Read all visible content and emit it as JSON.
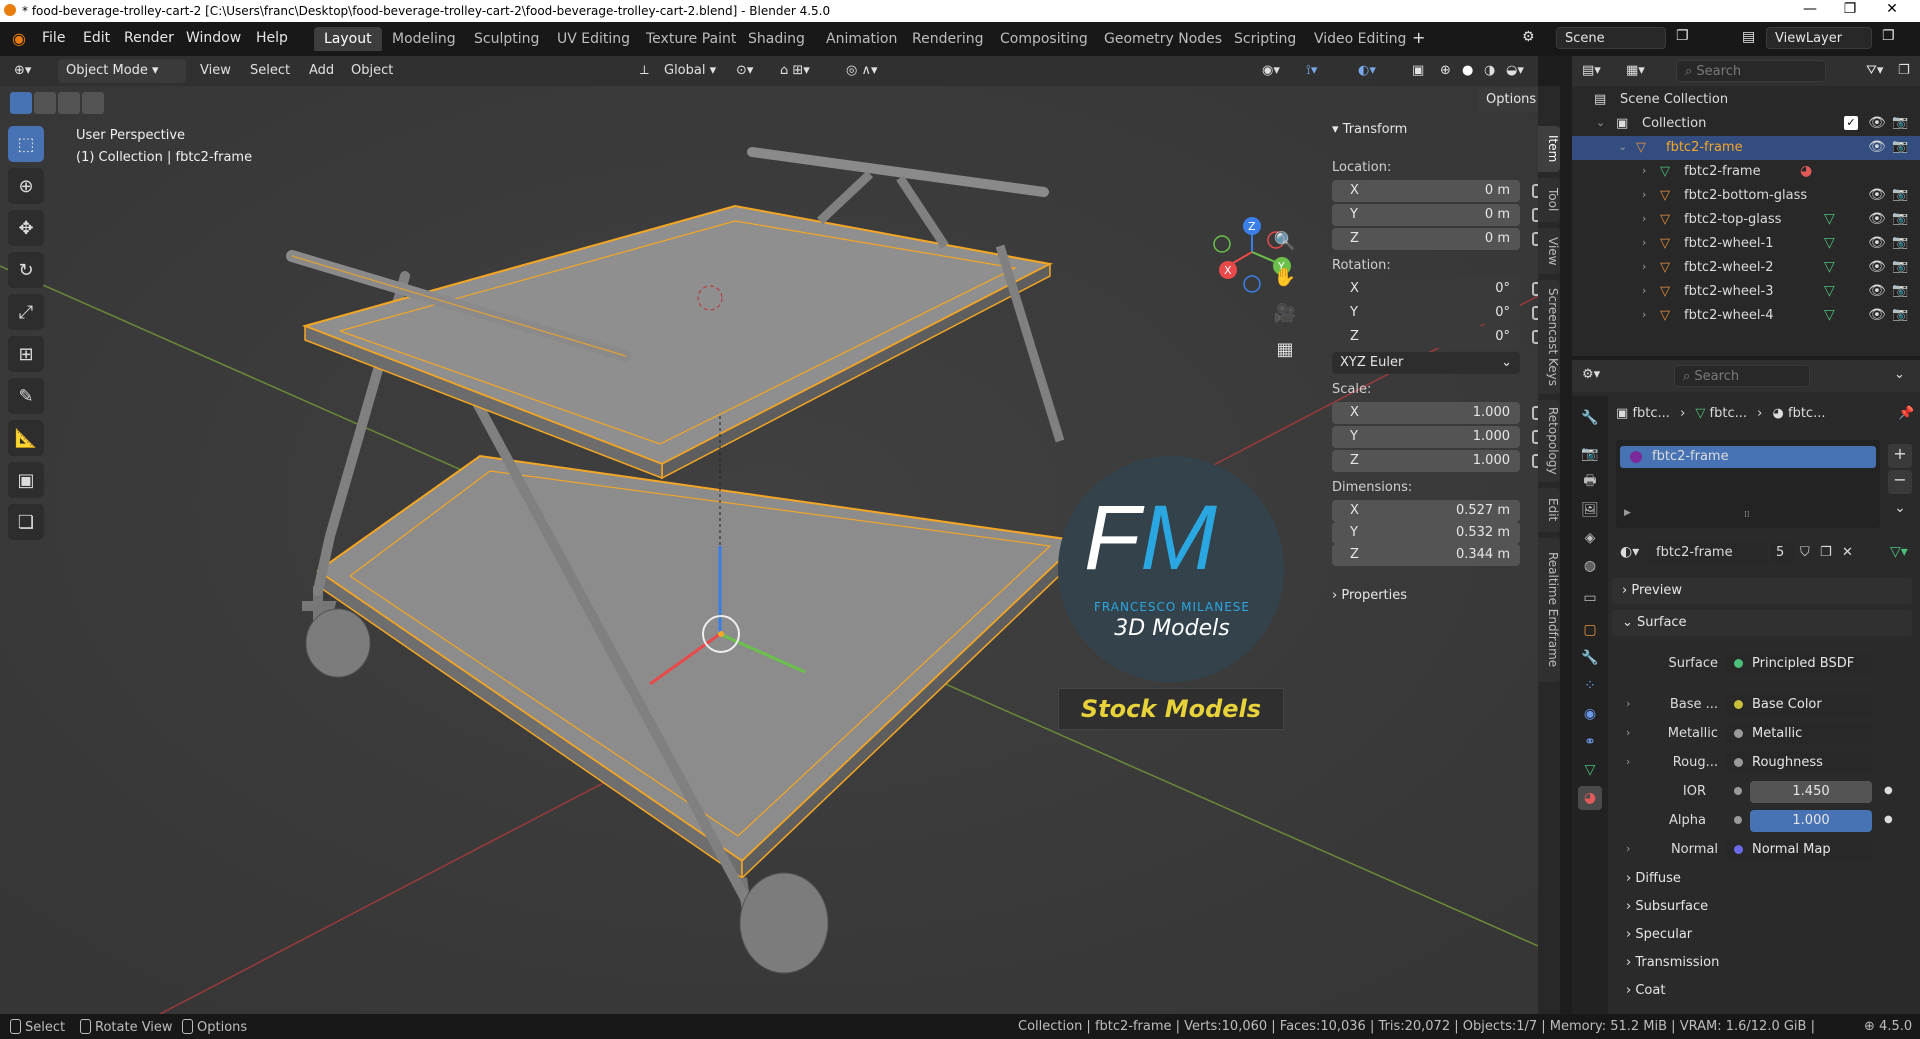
{
  "window": {
    "title": "* food-beverage-trolley-cart-2 [C:\\Users\\franc\\Desktop\\food-beverage-trolley-cart-2\\food-beverage-trolley-cart-2.blend] - Blender 4.5.0",
    "minimize": "—",
    "maximize": "❐",
    "close": "✕"
  },
  "menu": [
    "File",
    "Edit",
    "Render",
    "Window",
    "Help"
  ],
  "workspaces": [
    "Layout",
    "Modeling",
    "Sculpting",
    "UV Editing",
    "Texture Paint",
    "Shading",
    "Animation",
    "Rendering",
    "Compositing",
    "Geometry Nodes",
    "Scripting",
    "Video Editing"
  ],
  "add_workspace": "+",
  "scene": "Scene",
  "view_layer": "ViewLayer",
  "viewport_header": {
    "mode": "Object Mode",
    "menus": [
      "View",
      "Select",
      "Add",
      "Object"
    ],
    "transform_orientation": "Global",
    "options": "Options"
  },
  "viewport": {
    "perspective": "User Perspective",
    "context": "(1) Collection | fbtc2-frame",
    "gizmo_axes": {
      "x": "X",
      "y": "Y",
      "z": "Z"
    }
  },
  "badge": {
    "brand_left": "F",
    "brand_right": "M",
    "name": "FRANCESCO MILANESE",
    "sub": "3D Models",
    "banner": "Stock Models"
  },
  "transform": {
    "title": "Transform",
    "location_label": "Location:",
    "location": [
      {
        "axis": "X",
        "value": "0 m"
      },
      {
        "axis": "Y",
        "value": "0 m"
      },
      {
        "axis": "Z",
        "value": "0 m"
      }
    ],
    "rotation_label": "Rotation:",
    "rotation": [
      {
        "axis": "X",
        "value": "0°"
      },
      {
        "axis": "Y",
        "value": "0°"
      },
      {
        "axis": "Z",
        "value": "0°"
      }
    ],
    "rotation_mode": "XYZ Euler",
    "scale_label": "Scale:",
    "scale": [
      {
        "axis": "X",
        "value": "1.000"
      },
      {
        "axis": "Y",
        "value": "1.000"
      },
      {
        "axis": "Z",
        "value": "1.000"
      }
    ],
    "dimensions_label": "Dimensions:",
    "dimensions": [
      {
        "axis": "X",
        "value": "0.527 m"
      },
      {
        "axis": "Y",
        "value": "0.532 m"
      },
      {
        "axis": "Z",
        "value": "0.344 m"
      }
    ],
    "properties": "Properties"
  },
  "side_tabs": [
    "Item",
    "Tool",
    "View",
    "Screencast Keys",
    "Retopology",
    "Edit",
    "Realtime Endframe"
  ],
  "outliner": {
    "search_placeholder": "Search",
    "rows": [
      {
        "label": "Scene Collection"
      },
      {
        "label": "Collection"
      },
      {
        "label": "fbtc2-frame"
      },
      {
        "label": "fbtc2-frame"
      },
      {
        "label": "fbtc2-bottom-glass"
      },
      {
        "label": "fbtc2-top-glass"
      },
      {
        "label": "fbtc2-wheel-1"
      },
      {
        "label": "fbtc2-wheel-2"
      },
      {
        "label": "fbtc2-wheel-3"
      },
      {
        "label": "fbtc2-wheel-4"
      }
    ]
  },
  "properties": {
    "search_placeholder": "Search",
    "breadcrumb": [
      "fbtc...",
      "fbtc...",
      "fbtc..."
    ],
    "material_slot": "fbtc2-frame",
    "material_name": "fbtc2-frame",
    "user_count": "5",
    "preview": "Preview",
    "surface_section": "Surface",
    "surface_label": "Surface",
    "surface_value": "Principled BSDF",
    "rows": [
      {
        "label": "Base ...",
        "value": "Base Color",
        "dot": "#c8c03a"
      },
      {
        "label": "Metallic",
        "value": "Metallic",
        "dot": "#9a9a9a"
      },
      {
        "label": "Roug...",
        "value": "Roughness",
        "dot": "#9a9a9a"
      }
    ],
    "ior_label": "IOR",
    "ior_value": "1.450",
    "alpha_label": "Alpha",
    "alpha_value": "1.000",
    "normal_label": "Normal",
    "normal_value": "Normal Map",
    "subsections": [
      "Diffuse",
      "Subsurface",
      "Specular",
      "Transmission",
      "Coat"
    ]
  },
  "statusbar": {
    "select": "Select",
    "rotate": "Rotate View",
    "options": "Options",
    "stats": "Collection | fbtc2-frame | Verts:10,060 | Faces:10,036 | Tris:20,072 | Objects:1/7 | Memory: 51.2 MiB | VRAM: 1.6/12.0 GiB |",
    "version": "4.5.0"
  },
  "colors": {
    "accent": "#4772b3",
    "selection": "#f5a623",
    "badge_blue": "#2aa7e0",
    "badge_yellow": "#e8d23a"
  }
}
